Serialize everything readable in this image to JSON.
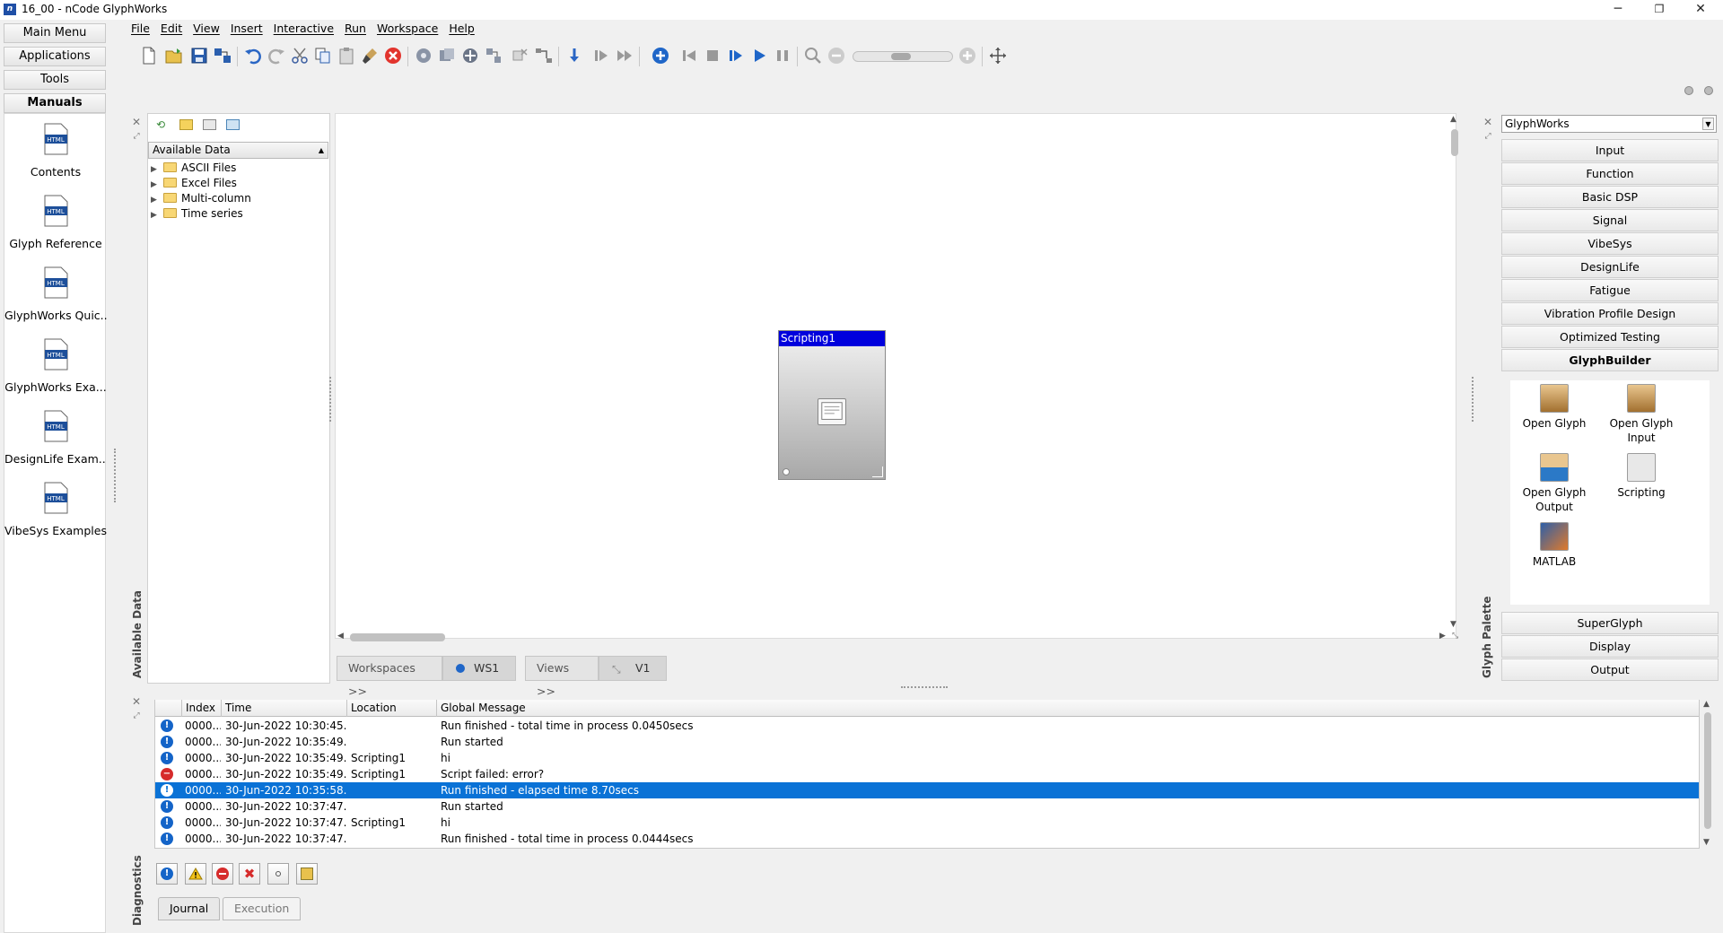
{
  "window": {
    "title": "16_00 - nCode GlyphWorks",
    "app_icon_text": "n",
    "minimize": "─",
    "restore": "❐",
    "close": "✕"
  },
  "menu": [
    "File",
    "Edit",
    "View",
    "Insert",
    "Interactive",
    "Run",
    "Workspace",
    "Help"
  ],
  "left_nav": {
    "buttons": [
      "Main Menu",
      "Applications",
      "Tools",
      "Manuals"
    ],
    "active": "Manuals",
    "manuals": [
      "Contents",
      "Glyph Reference",
      "GlyphWorks Quic...",
      "GlyphWorks Exa...",
      "DesignLife Exam...",
      "VibeSys Examples"
    ],
    "doc_icon_text": "HTML"
  },
  "data_panel": {
    "caption": "Available Data",
    "header": "Available Data",
    "items": [
      "ASCII Files",
      "Excel Files",
      "Multi-column",
      "Time series"
    ]
  },
  "workspace": {
    "glyph_title": "Scripting1",
    "tabs": {
      "workspaces": "Workspaces >>",
      "ws1": "WS1",
      "views": "Views >>",
      "v1": "V1"
    }
  },
  "palette": {
    "caption": "Glyph Palette",
    "selected": "GlyphWorks",
    "categories_top": [
      "Input",
      "Function",
      "Basic DSP",
      "Signal",
      "VibeSys",
      "DesignLife",
      "Fatigue",
      "Vibration Profile Design",
      "Optimized Testing",
      "GlyphBuilder"
    ],
    "categories_bottom": [
      "SuperGlyph",
      "Display",
      "Output"
    ],
    "active_category": "GlyphBuilder",
    "glyphs": [
      "Open Glyph",
      "Open Glyph Input",
      "Open Glyph Output",
      "Scripting",
      "MATLAB"
    ]
  },
  "diagnostics": {
    "caption": "Diagnostics",
    "columns": [
      "Index",
      "Time",
      "Location",
      "Global Message"
    ],
    "rows": [
      {
        "type": "info",
        "index": "0000...",
        "time": "30-Jun-2022 10:30:45...",
        "location": "",
        "message": "Run finished - total time in process 0.0450secs"
      },
      {
        "type": "info",
        "index": "0000...",
        "time": "30-Jun-2022 10:35:49...",
        "location": "",
        "message": "Run started"
      },
      {
        "type": "info",
        "index": "0000...",
        "time": "30-Jun-2022 10:35:49...",
        "location": "Scripting1",
        "message": "hi"
      },
      {
        "type": "error",
        "index": "0000...",
        "time": "30-Jun-2022 10:35:49...",
        "location": "Scripting1",
        "message": "Script failed: error?"
      },
      {
        "type": "info",
        "index": "0000...",
        "time": "30-Jun-2022 10:35:58...",
        "location": "",
        "message": "Run finished - elapsed time 8.70secs",
        "selected": true
      },
      {
        "type": "info",
        "index": "0000...",
        "time": "30-Jun-2022 10:37:47...",
        "location": "",
        "message": "Run started"
      },
      {
        "type": "info",
        "index": "0000...",
        "time": "30-Jun-2022 10:37:47...",
        "location": "Scripting1",
        "message": "hi"
      },
      {
        "type": "info",
        "index": "0000...",
        "time": "30-Jun-2022 10:37:47...",
        "location": "",
        "message": "Run finished - total time in process 0.0444secs"
      }
    ],
    "tabs": [
      "Journal",
      "Execution"
    ],
    "active_tab": "Journal"
  },
  "colors": {
    "selection": "#0a72d6",
    "glyph_title_bar": "#0000dd",
    "info_icon": "#1464c8",
    "error_icon": "#d62b2b"
  }
}
